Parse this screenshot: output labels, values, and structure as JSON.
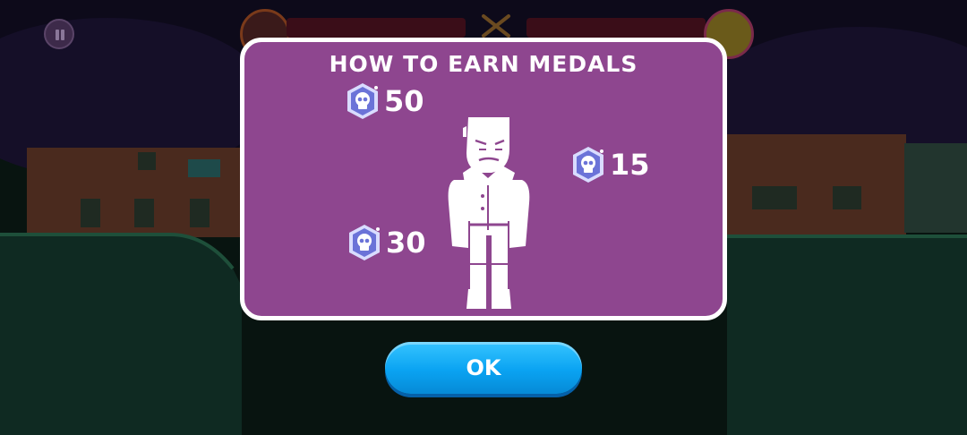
{
  "dialog": {
    "title": "HOW TO EARN MEDALS",
    "medals": [
      {
        "part": "head",
        "value": "50"
      },
      {
        "part": "arm",
        "value": "15"
      },
      {
        "part": "body",
        "value": "30"
      }
    ]
  },
  "ok_button": {
    "label": "OK"
  },
  "colors": {
    "dialog_background": "#8e468f",
    "dialog_border": "#ffffff",
    "button_blue": "#0aa3f2",
    "medal_fill": "#6b73d8"
  },
  "icons": [
    "pause-icon",
    "skull-medal-icon",
    "crossed-swords-icon",
    "character-silhouette"
  ]
}
